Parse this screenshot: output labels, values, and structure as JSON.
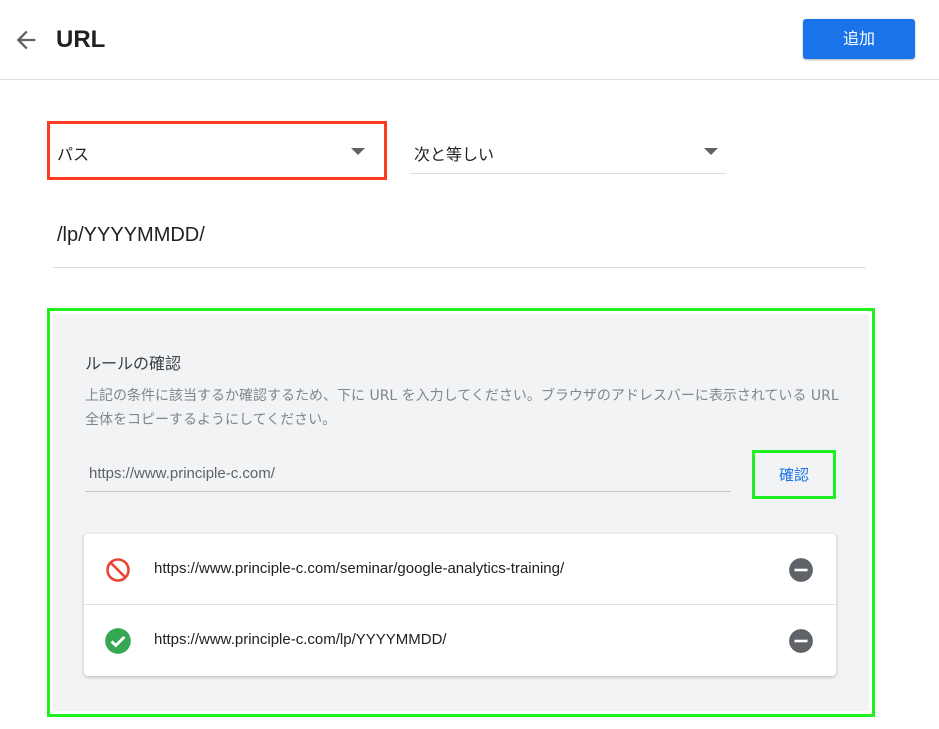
{
  "header": {
    "title": "URL",
    "add_label": "追加",
    "back_icon": "arrow-left-icon"
  },
  "condition": {
    "match_type": "パス",
    "operator": "次と等しい",
    "value": "/lp/YYYYMMDD/"
  },
  "rule_check": {
    "title": "ルールの確認",
    "description": "上記の条件に該当するか確認するため、下に URL を入力してください。ブラウザのアドレスバーに表示されている URL 全体をコピーするようにしてください。",
    "input_placeholder": "https://www.principle-c.com/",
    "confirm_label": "確認",
    "results": [
      {
        "url": "https://www.principle-c.com/seminar/google-analytics-training/",
        "status": "no-match",
        "icon": "block-icon",
        "color": "#ea4335"
      },
      {
        "url": "https://www.principle-c.com/lp/YYYYMMDD/",
        "status": "match",
        "icon": "check-circle-icon",
        "color": "#34a853"
      }
    ]
  },
  "colors": {
    "accent": "#1a73e8",
    "panel_bg": "#f1f3f4",
    "highlight_red": "#ff3b1f",
    "highlight_green": "#1ff01f"
  }
}
